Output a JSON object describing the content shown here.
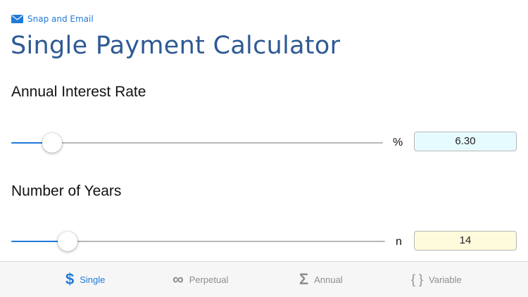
{
  "header": {
    "snap_label": "Snap and Email",
    "title": "Single Payment Calculator"
  },
  "interest": {
    "label": "Annual Interest Rate",
    "unit": "%",
    "value": "6.30",
    "slider_fraction": 0.11
  },
  "years": {
    "label": "Number of Years",
    "unit": "n",
    "value": "14",
    "slider_fraction": 0.15
  },
  "tabs": [
    {
      "label": "Single",
      "icon": "dollar-icon",
      "glyph": "$",
      "active": true
    },
    {
      "label": "Perpetual",
      "icon": "infinity-icon",
      "glyph": "∞",
      "active": false
    },
    {
      "label": "Annual",
      "icon": "sigma-icon",
      "glyph": "Σ",
      "active": false
    },
    {
      "label": "Variable",
      "icon": "braces-icon",
      "glyph": "{ }",
      "active": false
    }
  ],
  "colors": {
    "accent": "#1f7ad8",
    "title": "#2e5a94",
    "rate_field_bg": "#e6fbff",
    "years_field_bg": "#fefbdc",
    "tab_inactive": "#8e8e8e"
  }
}
